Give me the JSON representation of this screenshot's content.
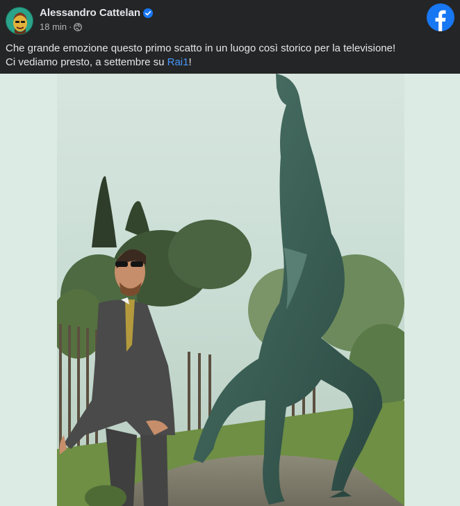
{
  "post": {
    "author": "Alessandro Cattelan",
    "time": "18 min",
    "separator": "·",
    "caption_line1": "Che grande emozione questo primo scatto in un luogo così storico per la televisione!",
    "caption_line2_prefix": "Ci vediamo presto, a settembre su ",
    "caption_link": "Rai1",
    "caption_line2_suffix": "!"
  },
  "icons": {
    "verified": "verified-badge-icon",
    "privacy": "globe-icon",
    "brand": "facebook-logo-icon"
  },
  "colors": {
    "background": "#242526",
    "text": "#e4e6eb",
    "secondary_text": "#b0b3b8",
    "link": "#4599ff",
    "facebook_blue": "#1877f2",
    "media_backdrop": "#dcebe3"
  }
}
